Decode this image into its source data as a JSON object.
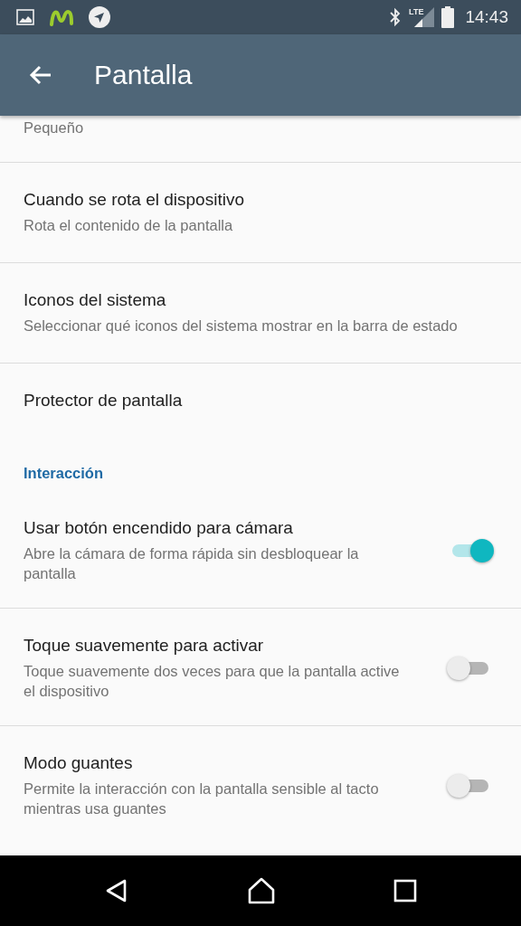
{
  "status_bar": {
    "network": "LTE",
    "time": "14:43"
  },
  "app_bar": {
    "title": "Pantalla"
  },
  "items": [
    {
      "kind": "summary",
      "summary": "Pequeño"
    },
    {
      "kind": "text",
      "title": "Cuando se rota el dispositivo",
      "summary": "Rota el contenido de la pantalla"
    },
    {
      "kind": "text",
      "title": "Iconos del sistema",
      "summary": "Seleccionar qué iconos del sistema mostrar en la barra de estado"
    },
    {
      "kind": "text",
      "title": "Protector de pantalla"
    },
    {
      "kind": "category",
      "title": "Interacción"
    },
    {
      "kind": "switch",
      "title": "Usar botón encendido para cámara",
      "summary": "Abre la cámara de forma rápida sin desbloquear la pantalla",
      "on": true
    },
    {
      "kind": "switch",
      "title": "Toque suavemente para activar",
      "summary": "Toque suavemente dos veces para que la pantalla active el dispositivo",
      "on": false
    },
    {
      "kind": "switch",
      "title": "Modo guantes",
      "summary": "Permite la interacción con la pantalla sensible al tacto mientras usa guantes",
      "on": false
    }
  ]
}
